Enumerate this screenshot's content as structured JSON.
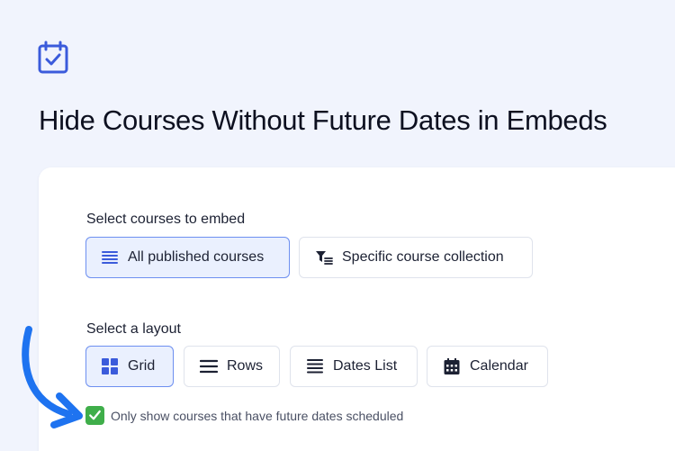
{
  "header": {
    "icon": "calendar-check-icon",
    "title": "Hide Courses Without Future Dates in Embeds"
  },
  "courses_section": {
    "label": "Select courses to embed",
    "options": [
      {
        "label": "All published courses",
        "icon": "list-icon",
        "selected": true
      },
      {
        "label": "Specific course collection",
        "icon": "filter-list-icon",
        "selected": false
      }
    ]
  },
  "layout_section": {
    "label": "Select a layout",
    "options": [
      {
        "label": "Grid",
        "icon": "grid-icon",
        "selected": true
      },
      {
        "label": "Rows",
        "icon": "rows-icon",
        "selected": false
      },
      {
        "label": "Dates List",
        "icon": "list-icon",
        "selected": false
      },
      {
        "label": "Calendar",
        "icon": "calendar-icon",
        "selected": false
      }
    ]
  },
  "future_dates_option": {
    "label": "Only show courses that have future dates scheduled",
    "checked": true,
    "icon": "checkmark-icon"
  },
  "annotation": {
    "icon": "arrow-icon"
  },
  "colors": {
    "background": "#f1f4fd",
    "accent": "#3b5bdb",
    "selected_fill": "#eaf0fe",
    "selected_border": "#6d8ff0",
    "arrow": "#1e73f0",
    "check": "#3fae4a"
  }
}
